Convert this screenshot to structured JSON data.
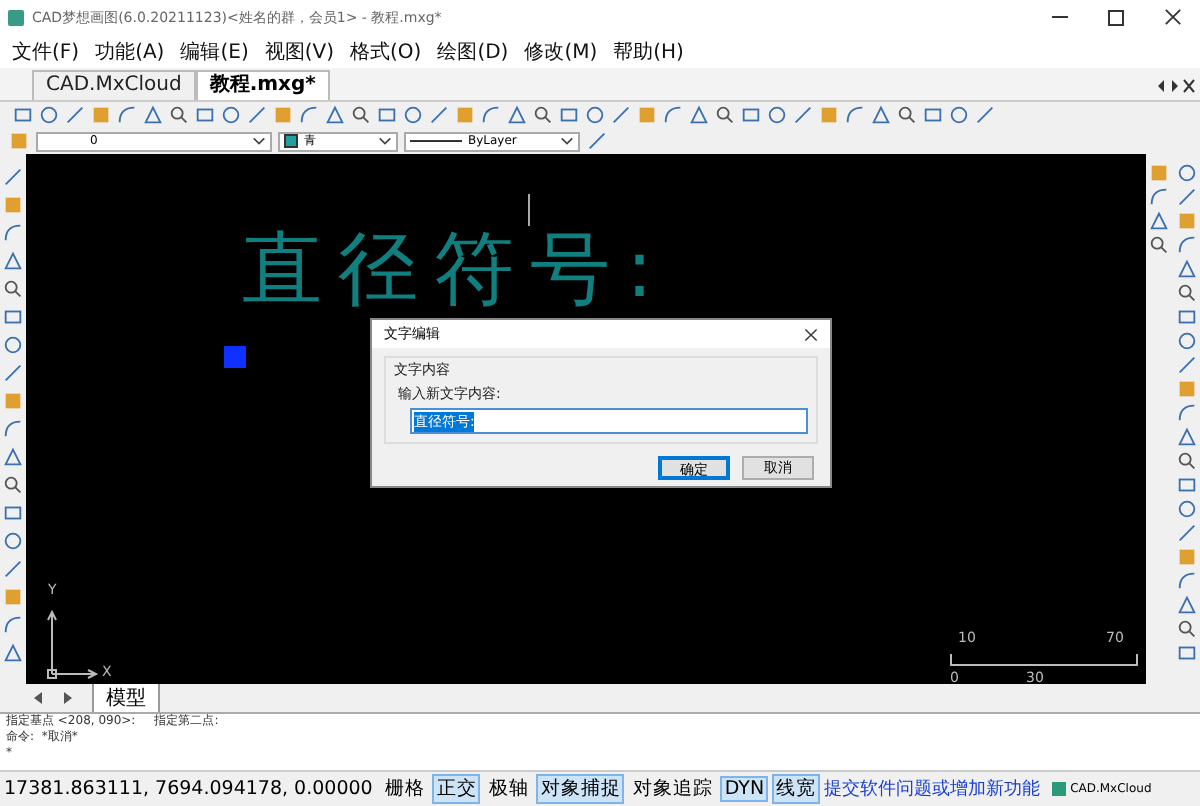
{
  "window": {
    "title": "CAD梦想画图(6.0.20211123)<姓名的群，会员1> - 教程.mxg*"
  },
  "menu": [
    "文件(F)",
    "功能(A)",
    "编辑(E)",
    "视图(V)",
    "格式(O)",
    "绘图(D)",
    "修改(M)",
    "帮助(H)"
  ],
  "doc_tabs": [
    {
      "label": "CAD.MxCloud",
      "selected": false
    },
    {
      "label": "教程.mxg*",
      "selected": true
    }
  ],
  "properties": {
    "layer": "0",
    "color_label": "青",
    "linetype": "ByLayer"
  },
  "canvas": {
    "text": "直径符号:",
    "scale_labels": [
      "10",
      "70",
      "0",
      "30"
    ],
    "axis_x": "X",
    "axis_y": "Y"
  },
  "dialog": {
    "title": "文字编辑",
    "group": "文字内容",
    "prompt": "输入新文字内容:",
    "value": "直径符号:",
    "buttons": [
      {
        "label": "确定",
        "default": true
      },
      {
        "label": "取消",
        "default": false
      }
    ]
  },
  "layout_tabs": [
    {
      "label": "模型",
      "selected": true
    }
  ],
  "command_lines": [
    "指定基点 <208, 090>:     指定第二点:",
    "命令:  *取消*",
    "*"
  ],
  "status_bar": {
    "coords": "17381.863111, 7694.094178, 0.00000",
    "toggles": [
      {
        "label": "栅格",
        "on": false
      },
      {
        "label": "正交",
        "on": true
      },
      {
        "label": "极轴",
        "on": false
      },
      {
        "label": "对象捕捉",
        "on": true
      },
      {
        "label": "对象追踪",
        "on": false
      },
      {
        "label": "DYN",
        "on": true
      },
      {
        "label": "线宽",
        "on": true
      }
    ],
    "link": "提交软件问题或增加新功能",
    "logo": "CAD.MxCloud"
  }
}
